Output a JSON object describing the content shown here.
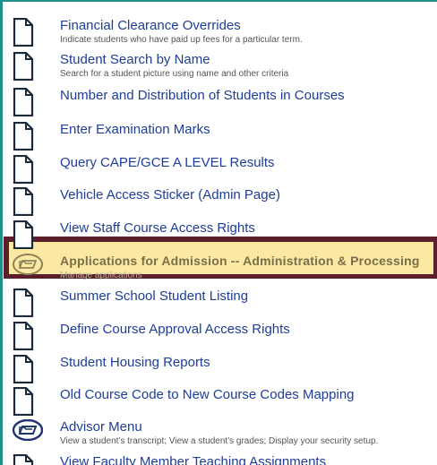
{
  "menu": {
    "items": [
      {
        "label": "Financial Clearance Overrides",
        "desc": "Indicate students who have paid up fees for a particular term.",
        "icon": "document-icon"
      },
      {
        "label": "Student Search by Name",
        "desc": "Search for a student picture using name and other criteria",
        "icon": "document-icon"
      },
      {
        "label": "Number and Distribution of Students in Courses",
        "desc": "",
        "icon": "document-icon"
      },
      {
        "label": "Enter Examination Marks",
        "desc": "",
        "icon": "document-icon"
      },
      {
        "label": "Query CAPE/GCE A LEVEL Results",
        "desc": "",
        "icon": "document-icon"
      },
      {
        "label": "Vehicle Access Sticker (Admin Page)",
        "desc": "",
        "icon": "document-icon"
      },
      {
        "label": "View Staff Course Access Rights",
        "desc": "",
        "icon": "document-icon"
      },
      {
        "label": "Applications for Admission -- Administration & Processing",
        "desc": "Manage applications",
        "icon": "folder-menu-icon"
      },
      {
        "label": "Summer School Student Listing",
        "desc": "",
        "icon": "document-icon"
      },
      {
        "label": "Define Course Approval Access Rights",
        "desc": "",
        "icon": "document-icon"
      },
      {
        "label": "Student Housing Reports",
        "desc": "",
        "icon": "document-icon"
      },
      {
        "label": "Old Course Code to New Course Codes Mapping",
        "desc": "",
        "icon": "document-icon"
      },
      {
        "label": "Advisor Menu",
        "desc": "View a student's transcript; View a student's grades; Display your security setup.",
        "icon": "folder-menu-icon"
      },
      {
        "label": "View Faculty Member Teaching Assignments",
        "desc": "",
        "icon": "document-icon"
      }
    ]
  },
  "colors": {
    "frame": "#1e8f8c",
    "link": "#1d3d99",
    "highlight_border": "#5a1f2a",
    "highlight_fill": "#fbe9a3"
  }
}
